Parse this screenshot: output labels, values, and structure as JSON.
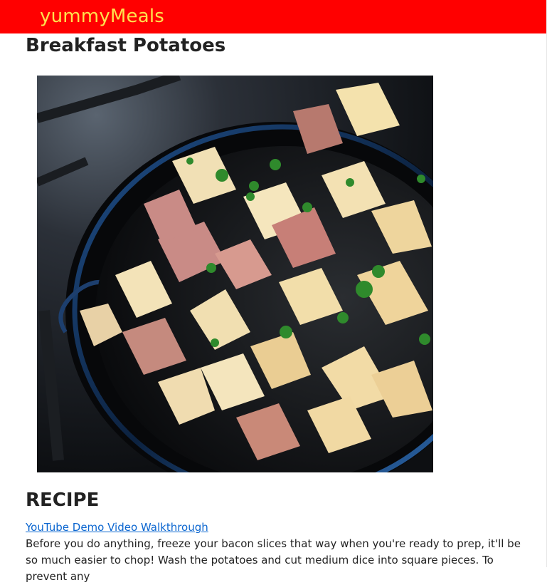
{
  "navbar": {
    "brand": "yummyMeals"
  },
  "recipe": {
    "title": "Breakfast Potatoes",
    "image_alt": "Breakfast potatoes in a cast iron skillet",
    "section_heading": "RECIPE",
    "video_link_text": "YouTube Demo Video Walkthrough",
    "instructions": "Before you do anything, freeze your bacon slices that way when you're ready to prep, it'll be so much easier to chop! Wash the potatoes and cut medium dice into square pieces. To prevent any"
  },
  "colors": {
    "navbar_bg": "#ff0000",
    "brand_text": "#ffe14d",
    "link": "#0b66d0"
  }
}
